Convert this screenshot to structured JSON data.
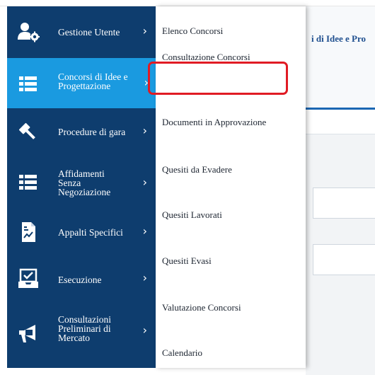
{
  "main_menu": {
    "items": [
      {
        "label": "Gestione Utente",
        "icon": "user-gear-icon"
      },
      {
        "label": "Concorsi di Idee e Progettazione",
        "icon": "list-icon",
        "active": true
      },
      {
        "label": "Procedure di gara",
        "icon": "gavel-icon"
      },
      {
        "label": "Affidamenti Senza Negoziazione",
        "icon": "list-icon"
      },
      {
        "label": "Appalti Specifici",
        "icon": "document-chart-icon"
      },
      {
        "label": "Esecuzione",
        "icon": "inbox-check-icon"
      },
      {
        "label": "Consultazioni Preliminari di Mercato",
        "icon": "megaphone-icon"
      }
    ],
    "chevron": "›"
  },
  "submenu": {
    "items": [
      {
        "label": "Elenco Concorsi"
      },
      {
        "label": "Consultazione Concorsi",
        "highlighted": true
      },
      {
        "label": "Documenti in Approvazione"
      },
      {
        "label": "Quesiti da Evadere"
      },
      {
        "label": "Quesiti Lavorati"
      },
      {
        "label": "Quesiti Evasi"
      },
      {
        "label": "Valutazione Concorsi"
      },
      {
        "label": "Calendario"
      }
    ]
  },
  "background_page": {
    "tab_title": "i di Idee e Pro"
  },
  "colors": {
    "menu_bg": "#0e3d6e",
    "active_bg": "#1a9ae0",
    "highlight": "#e01b24",
    "accent": "#1b67b3"
  }
}
